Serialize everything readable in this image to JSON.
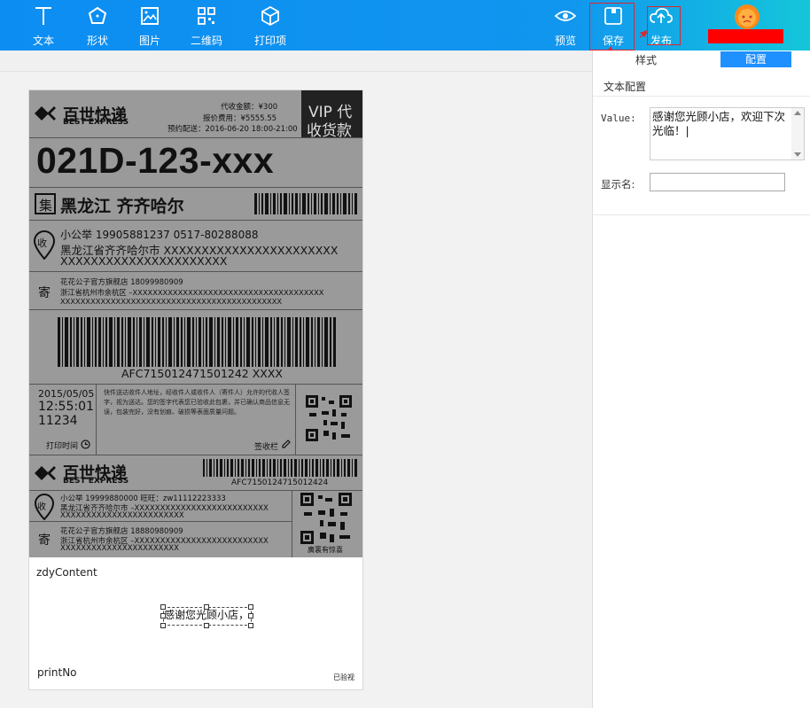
{
  "toolbar": {
    "left": [
      {
        "label": "文本",
        "icon": "text-icon"
      },
      {
        "label": "形状",
        "icon": "shape-icon"
      },
      {
        "label": "图片",
        "icon": "image-icon"
      },
      {
        "label": "二维码",
        "icon": "qrcode-icon"
      },
      {
        "label": "打印项",
        "icon": "cube-icon"
      }
    ],
    "preview": "预览",
    "save": "保存",
    "publish": "发布"
  },
  "panel": {
    "tab_style": "样式",
    "tab_config": "配置",
    "section_title": "文本配置",
    "value_label": "Value:",
    "value_text": "感谢您光顾小店，欢迎下次光临！|",
    "display_name_label": "显示名:",
    "display_name_value": ""
  },
  "label": {
    "brand_cn": "百世快递",
    "brand_en": "BEST EXPRESS",
    "cod": "代收金额：¥300",
    "fee": "报价费用：¥5555.55",
    "appointment": "预约配送：2016-06-20 18:00-21:00",
    "vip_line1": "VIP 代",
    "vip_line2": "收货款",
    "route_code": "021D-123-xxx",
    "ji": "集",
    "destination": "黑龙江  齐齐哈尔",
    "shou": "收",
    "receiver_line": "小公举    19905881237    0517-80288088",
    "receiver_addr1": "黑龙江省齐齐哈尔市 XXXXXXXXXXXXXXXXXXXXXXX",
    "receiver_addr2": "XXXXXXXXXXXXXXXXXXXXXX",
    "ji_sender": "寄",
    "sender_line": "花花公子官方旗舰店    18099980909",
    "sender_addr1": "浙江省杭州市余杭区 –XXXXXXXXXXXXXXXXXXXXXXXXXXXXXXXXXXXXXX",
    "sender_addr2": "XXXXXXXXXXXXXXXXXXXXXXXXXXXXXXXXXXXXXXXXXXXX",
    "barcode_no": "AFC715012471501242 XXXX",
    "date": "2015/05/05",
    "time": "12:55:01",
    "num": "11234",
    "print_time": "打印时间",
    "terms": "快件送达收件人地址，经收件人或收件人（寄件人）允许的代收人签字，视为送达。您的签字代表您已验收此包裹，并已确认商品信息无误，包装完好，没有划痕、破损等表面质量问题。",
    "sign": "签收栏",
    "barcode_no2": "AFC7150124715012424",
    "r_line": "小公举    19999880000    旺旺：zw11112223333",
    "r_addr1": "黑龙江省齐齐哈尔市 –XXXXXXXXXXXXXXXXXXXXXXXXXX",
    "r_addr2": "XXXXXXXXXXXXXXXXXXXXXXXX",
    "s_line": "花花公子官方旗舰店    18880980909",
    "s_addr1": "浙江省杭州市余杭区 –XXXXXXXXXXXXXXXXXXXXXXXXXX",
    "s_addr2": "XXXXXXXXXXXXXXXXXXXXXXX",
    "qr_caption": "廣裏有惊喜"
  },
  "custom": {
    "zdy": "zdyContent",
    "thanks": "感谢您光顾小店，",
    "printno": "printNo",
    "checked": "已验视"
  }
}
